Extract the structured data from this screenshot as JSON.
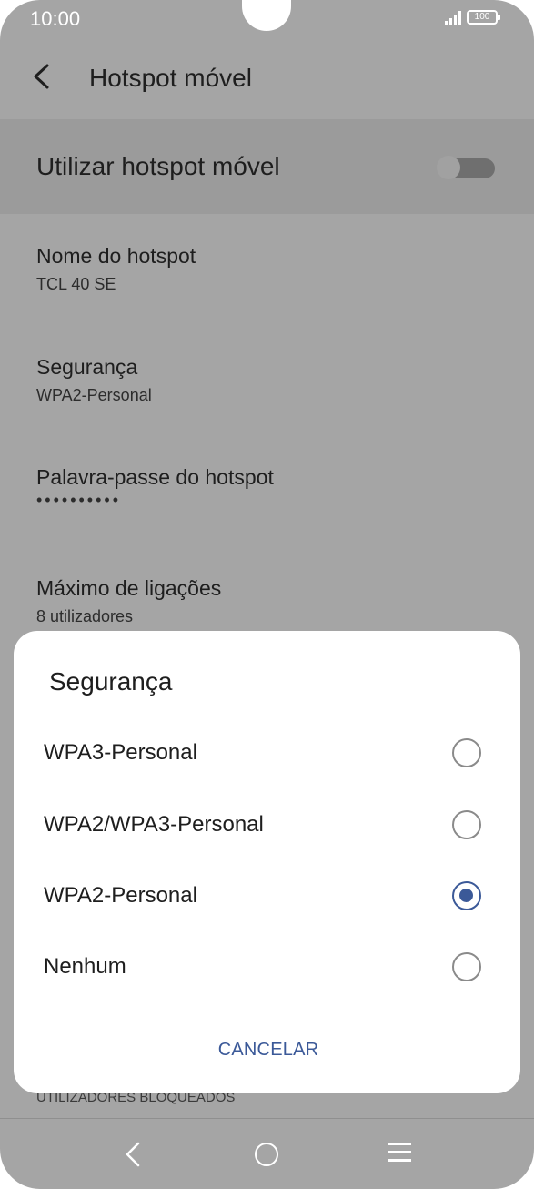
{
  "status_bar": {
    "time": "10:00",
    "battery": "100"
  },
  "app_bar": {
    "title": "Hotspot móvel"
  },
  "master_switch": {
    "label": "Utilizar hotspot móvel",
    "enabled": false
  },
  "settings": [
    {
      "title": "Nome do hotspot",
      "value": "TCL 40 SE"
    },
    {
      "title": "Segurança",
      "value": "WPA2-Personal"
    },
    {
      "title": "Palavra-passe do hotspot",
      "value": "••••••••••"
    },
    {
      "title": "Máximo de ligações",
      "value": "8 utilizadores"
    }
  ],
  "blocked_section": "UTILIZADORES BLOQUEADOS",
  "dialog": {
    "title": "Segurança",
    "options": [
      {
        "label": "WPA3-Personal",
        "selected": false
      },
      {
        "label": "WPA2/WPA3-Personal",
        "selected": false
      },
      {
        "label": "WPA2-Personal",
        "selected": true
      },
      {
        "label": "Nenhum",
        "selected": false
      }
    ],
    "cancel_label": "CANCELAR"
  },
  "colors": {
    "accent": "#3b5998",
    "scrim": "#a5a5a5"
  }
}
